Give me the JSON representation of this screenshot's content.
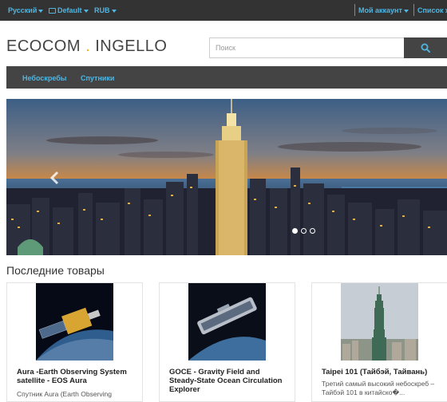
{
  "topbar": {
    "language": "Русский",
    "currency": "Default",
    "currency_code": "RUB",
    "account": "Мой аккаунт",
    "wishlist": "Список ж"
  },
  "header": {
    "logo_left": "ECOCOM",
    "logo_dot": ".",
    "logo_right": "INGELLO",
    "search_placeholder": "Поиск"
  },
  "nav": {
    "items": [
      {
        "label": "Небоскребы"
      },
      {
        "label": "Спутники"
      }
    ]
  },
  "slider": {
    "slide_count": 3,
    "active_slide": 1
  },
  "latest": {
    "title": "Последние товары",
    "products": [
      {
        "name": "Aura -Earth Observing System satellite - EOS Aura",
        "desc": "Спутник Aura (Earth Observing",
        "image": "satellite-aura"
      },
      {
        "name": "GOCE - Gravity Field and Steady-State Ocean Circulation Explorer",
        "desc": "",
        "image": "satellite-goce"
      },
      {
        "name": "Taipei 101 (Тайбэй, Тайвань)",
        "desc": "Третий самый высокий небоскреб – Тайбэй 101 в китайско�...",
        "image": "taipei-101-tower"
      }
    ]
  },
  "colors": {
    "accent": "#4fb6e2",
    "dark_bar": "#333333",
    "nav_bar": "#444444",
    "logo_dot": "#f0b400"
  }
}
